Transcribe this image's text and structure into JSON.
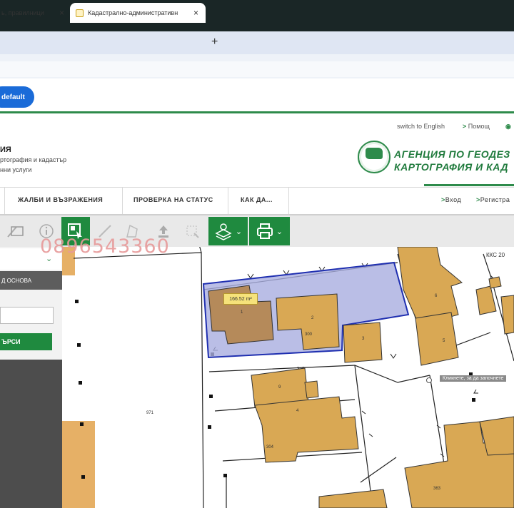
{
  "browser": {
    "tabs": [
      {
        "label": "ь, правилници",
        "active": false
      },
      {
        "label": "Кадастрално-административн",
        "active": true
      }
    ],
    "new_tab": "+",
    "close_glyph": "×",
    "default_button": "default"
  },
  "header": {
    "top_links": {
      "english": "switch to English",
      "help": "Помощ"
    },
    "agency_title": "ИЯ",
    "agency_line1": "ртография и кадастър",
    "agency_line2": "нни услуги",
    "logo_line1": "АГЕНЦИЯ ПО ГЕОДЕЗ",
    "logo_line2": "КАРТОГРАФИЯ И КАД"
  },
  "nav": {
    "items": [
      "ЖАЛБИ И ВЪЗРАЖЕНИЯ",
      "ПРОВЕРКА НА СТАТУС",
      "КАК ДА..."
    ],
    "login": "Вход",
    "register": "Регистра"
  },
  "watermark_phone": "0896543360",
  "sidebar": {
    "base_label": "Д ОСНОВА",
    "search_button": "ЪРСИ",
    "search_value": ""
  },
  "map": {
    "area_label": "166.52 m²",
    "tooltip": "Кликнете, за да започнете",
    "cadastral_label": "ККС 20",
    "parcel_labels": [
      "971",
      "1",
      "2",
      "3",
      "4",
      "5",
      "6",
      "9",
      "300",
      "304",
      "363"
    ]
  },
  "colors": {
    "accent_green": "#1f8a3f",
    "building": "#d9a854",
    "selection": "#1f2fb0"
  }
}
